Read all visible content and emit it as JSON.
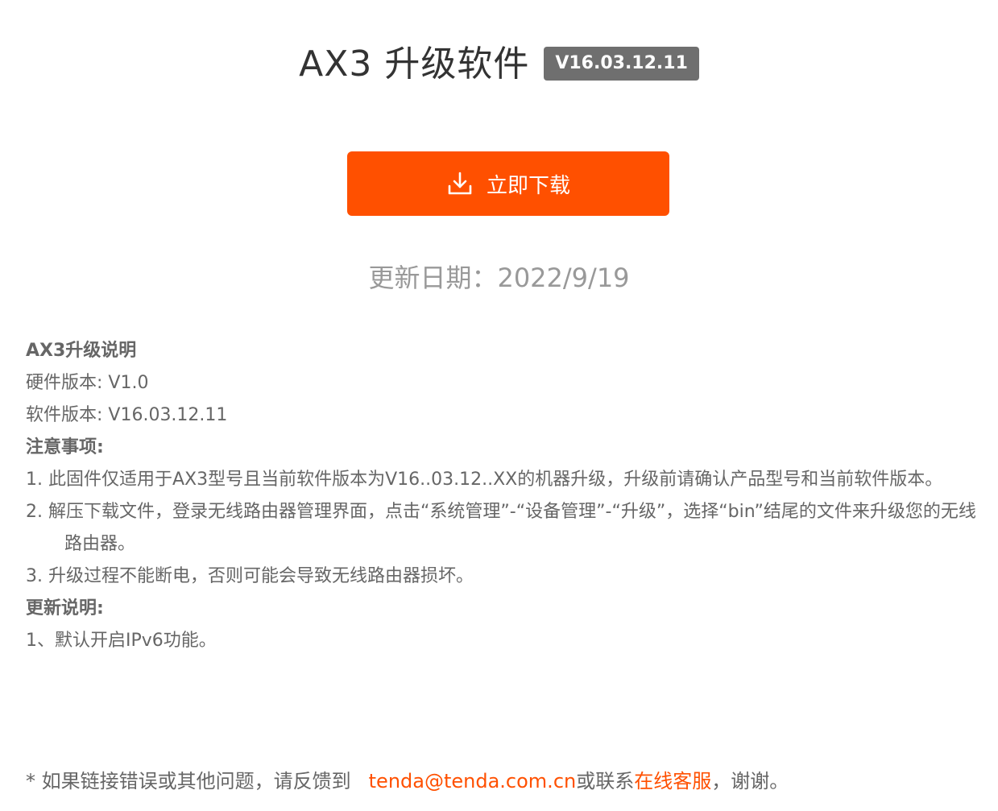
{
  "header": {
    "title": "AX3 升级软件",
    "version_badge": "V16.03.12.11"
  },
  "download": {
    "label": "立即下载",
    "icon": "download-icon"
  },
  "update_date": "更新日期：2022/9/19",
  "notes": {
    "heading": "AX3升级说明",
    "hardware_version": "硬件版本: V1.0",
    "software_version": "软件版本: V16.03.12.11",
    "caution_heading": "注意事项:",
    "caution_items": [
      "1. 此固件仅适用于AX3型号且当前软件版本为V16..03.12..XX的机器升级，升级前请确认产品型号和当前软件版本。",
      "2. 解压下载文件，登录无线路由器管理界面，点击“系统管理”-“设备管理”-“升级”，选择“bin”结尾的文件来升级您的无线路由器。",
      "3. 升级过程不能断电，否则可能会导致无线路由器损坏。"
    ],
    "changelog_heading": "更新说明:",
    "changelog_items": [
      "1、默认开启IPv6功能。"
    ]
  },
  "footer": {
    "prefix": "* 如果链接错误或其他问题，请反馈到",
    "email": "tenda@tenda.com.cn",
    "middle": "或联系",
    "support_link": "在线客服",
    "suffix": "，谢谢。"
  },
  "colors": {
    "accent": "#ff5000",
    "badge": "#6f6f6f",
    "text": "#666666"
  }
}
